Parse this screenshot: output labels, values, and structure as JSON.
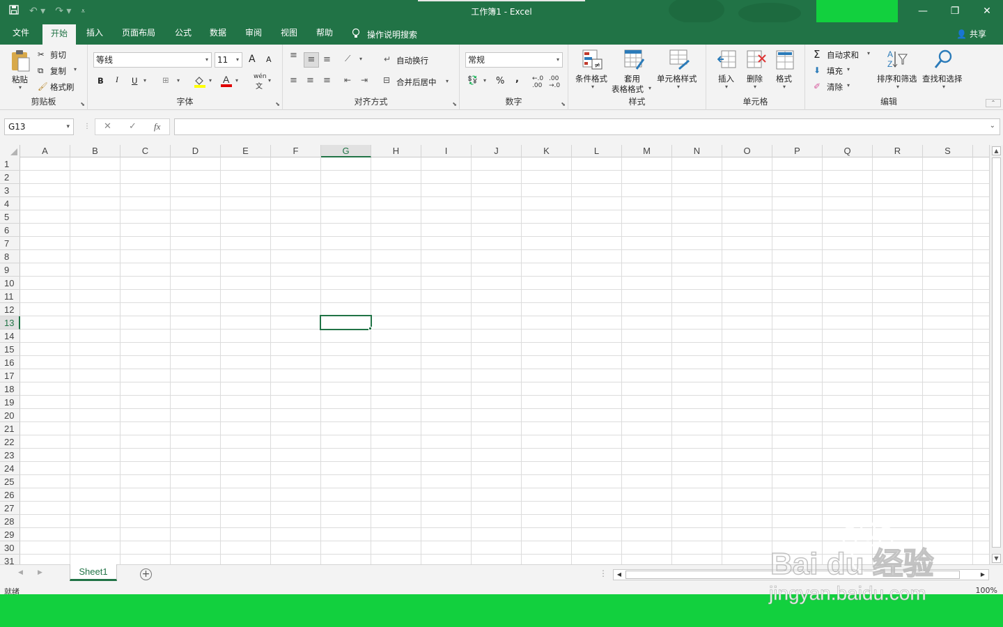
{
  "window": {
    "title": "工作簿1  -  Excel",
    "qat": {
      "save_icon": "save-icon",
      "undo_icon": "undo-icon",
      "redo_icon": "redo-icon"
    }
  },
  "tabs": {
    "file": "文件",
    "home": "开始",
    "insert": "插入",
    "page_layout": "页面布局",
    "formulas": "公式",
    "data": "数据",
    "review": "审阅",
    "view": "视图",
    "help": "帮助",
    "tell_me": "操作说明搜索",
    "share": "共享"
  },
  "ribbon": {
    "clipboard": {
      "label": "剪贴板",
      "paste": "粘贴",
      "cut": "剪切",
      "copy": "复制",
      "format_painter": "格式刷"
    },
    "font": {
      "label": "字体",
      "font_name": "等线",
      "font_size": "11",
      "bold": "B",
      "italic": "I",
      "underline": "U",
      "grow": "A",
      "shrink": "A",
      "phonetic": "wén"
    },
    "alignment": {
      "label": "对齐方式",
      "wrap": "自动换行",
      "merge": "合并后居中"
    },
    "number": {
      "label": "数字",
      "format": "常规",
      "percent": "%",
      "comma": ","
    },
    "styles": {
      "label": "样式",
      "conditional": "条件格式",
      "table1": "套用",
      "table2": "表格格式",
      "cell_styles": "单元格样式"
    },
    "cells": {
      "label": "单元格",
      "insert": "插入",
      "delete": "删除",
      "format": "格式"
    },
    "editing": {
      "label": "编辑",
      "autosum": "自动求和",
      "fill": "填充",
      "clear": "清除",
      "sort": "排序和筛选",
      "find": "查找和选择"
    }
  },
  "formula_bar": {
    "name_box": "G13",
    "fx": "fx",
    "value": ""
  },
  "grid": {
    "columns": [
      "A",
      "B",
      "C",
      "D",
      "E",
      "F",
      "G",
      "H",
      "I",
      "J",
      "K",
      "L",
      "M",
      "N",
      "O",
      "P",
      "Q",
      "R",
      "S"
    ],
    "rows": [
      "1",
      "2",
      "3",
      "4",
      "5",
      "6",
      "7",
      "8",
      "9",
      "10",
      "11",
      "12",
      "13",
      "14",
      "15",
      "16",
      "17",
      "18",
      "19",
      "20",
      "21",
      "22",
      "23",
      "24",
      "25",
      "26",
      "27",
      "28",
      "29",
      "30",
      "31"
    ],
    "selected_column": "G",
    "selected_row": "13"
  },
  "sheets": {
    "tabs": [
      "Sheet1"
    ]
  },
  "status": {
    "ready": "就绪",
    "zoom": "100%"
  },
  "watermark": {
    "brand": "Bai du 经验",
    "url": "jingyan.baidu.com"
  },
  "colors": {
    "accent": "#217346",
    "highlight_green": "#12d03e"
  }
}
